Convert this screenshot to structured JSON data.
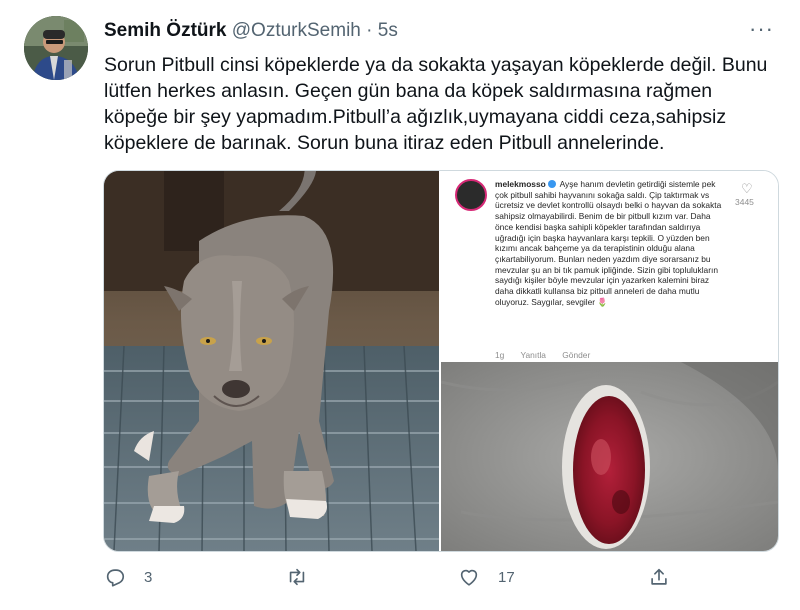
{
  "tweet": {
    "author_name": "Semih Öztürk",
    "handle": "@OzturkSemih",
    "separator": "·",
    "time": "5s",
    "text": "Sorun Pitbull cinsi köpeklerde ya da sokakta yaşayan köpeklerde değil. Bunu lütfen herkes anlasın. Geçen gün bana da köpek saldırmasına rağmen köpeğe bir şey yapmadım.Pitbull’a ağızlık,uymayana ciddi ceza,sahipsiz köpeklere de barınak. Sorun buna itiraz eden Pitbull annelerinde.",
    "more_label": "···"
  },
  "instagram": {
    "username": "melekmosso",
    "caption": "Ayşe hanım devletin getirdiği sistemle pek çok pitbull sahibi hayvanını sokağa saldı. Çip taktırmak vs ücretsiz ve devlet kontrollü olsaydı belki o hayvan da sokakta sahipsiz olmayabilirdi. Benim de bir pitbull kızım var. Daha önce kendisi başka sahipli köpekler tarafından saldırıya uğradığı için başka hayvanlara karşı tepkili. O yüzden ben kızımı ancak bahçeme ya da terapistinin olduğu alana çıkartabiliyorum. Bunları neden yazdım diye sorarsanız bu mevzular şu an bi tık pamuk ipliğinde. Sizin gibi toplulukların saydığı kişiler böyle mevzular için yazarken kalemini biraz daha dikkatli kullansa biz pitbull anneleri de daha mutlu oluyoruz. Saygılar, sevgiler 🌷",
    "likes": "3445",
    "time_ago": "1g",
    "reply_label": "Yanıtla",
    "send_label": "Gönder"
  },
  "actions": {
    "reply_count": "3",
    "retweet_count": "",
    "like_count": "17"
  },
  "colors": {
    "text": "#0f1419",
    "secondary": "#536471",
    "border": "#cfd9de",
    "ig_verified": "#3897f0"
  }
}
